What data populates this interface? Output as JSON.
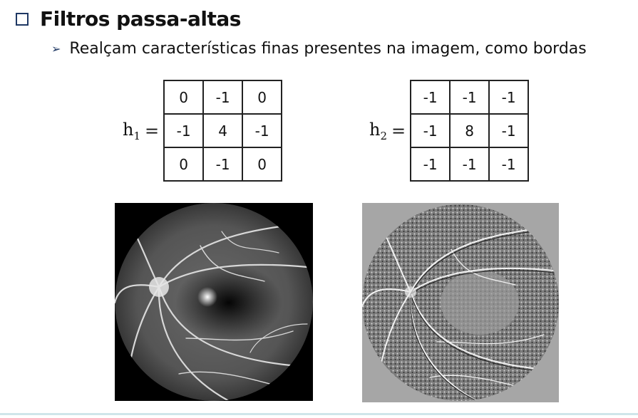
{
  "heading": {
    "title": "Filtros passa-altas"
  },
  "bullet": {
    "text": "Realçam características finas presentes na imagem, como bordas"
  },
  "kernels": [
    {
      "label": "h",
      "sub": "1",
      "eq": "=",
      "rows": [
        [
          "0",
          "-1",
          "0"
        ],
        [
          "-1",
          "4",
          "-1"
        ],
        [
          "0",
          "-1",
          "0"
        ]
      ]
    },
    {
      "label": "h",
      "sub": "2",
      "eq": "=",
      "rows": [
        [
          "-1",
          "-1",
          "-1"
        ],
        [
          "-1",
          "8",
          "-1"
        ],
        [
          "-1",
          "-1",
          "-1"
        ]
      ]
    }
  ],
  "colors": {
    "accent": "#1f3864"
  },
  "images": [
    {
      "name": "retina-fundus-angiography-original"
    },
    {
      "name": "retina-fundus-highpass-filtered"
    }
  ]
}
